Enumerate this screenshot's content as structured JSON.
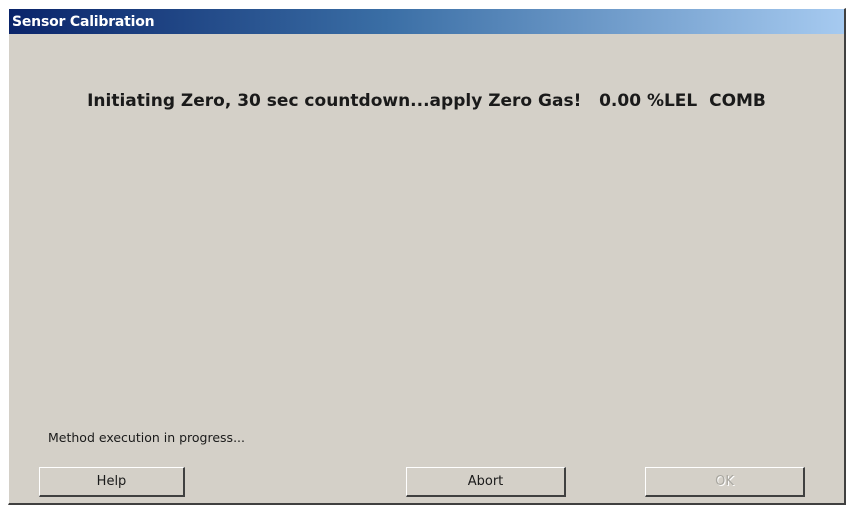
{
  "window": {
    "title": "Sensor Calibration"
  },
  "main": {
    "message": "Initiating Zero, 30 sec countdown...apply Zero Gas!   0.00 %LEL  COMB",
    "status": "Method execution in progress..."
  },
  "buttons": {
    "help_label": "Help",
    "abort_label": "Abort",
    "ok_label": "OK",
    "ok_enabled": false
  },
  "colors": {
    "dialog_background": "#d4d0c8",
    "titlebar_start": "#0a246a",
    "titlebar_end": "#a6caf0",
    "titlebar_text": "#ffffff"
  }
}
